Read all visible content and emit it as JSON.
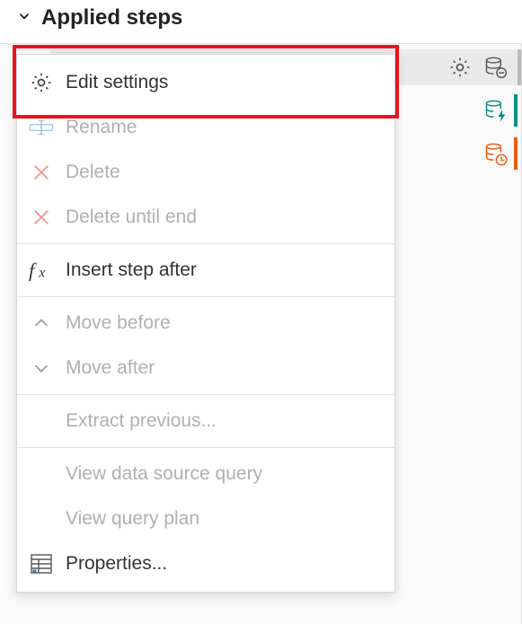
{
  "header": {
    "title": "Applied steps"
  },
  "menu": {
    "edit_settings": "Edit settings",
    "rename": "Rename",
    "delete": "Delete",
    "delete_until_end": "Delete until end",
    "insert_step_after": "Insert step after",
    "move_before": "Move before",
    "move_after": "Move after",
    "extract_previous": "Extract previous...",
    "view_data_source_query": "View data source query",
    "view_query_plan": "View query plan",
    "properties": "Properties..."
  },
  "icons": {
    "gear": "gear-icon",
    "db_remove": "database-remove-icon",
    "db_lightning": "database-lightning-icon",
    "db_clock": "database-clock-icon",
    "table": "table-icon"
  }
}
